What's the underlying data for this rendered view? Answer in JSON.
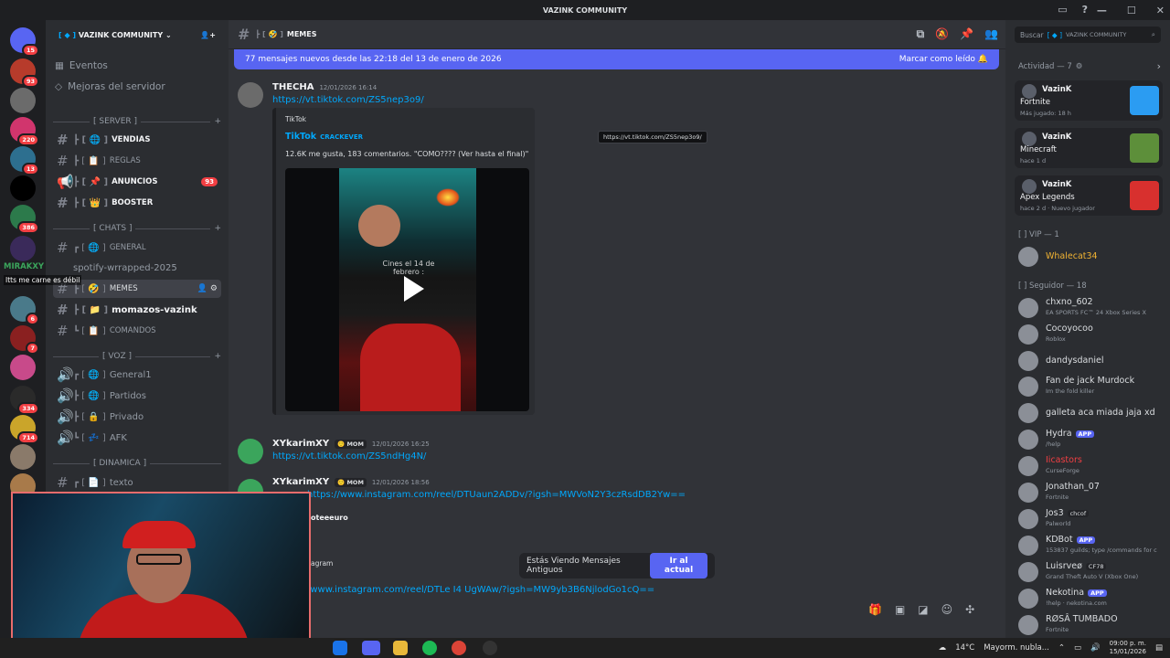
{
  "window": {
    "title": "VAZINK COMMUNITY"
  },
  "servers": [
    {
      "badge": "15"
    },
    {
      "badge": "93"
    },
    {
      "badge": ""
    },
    {
      "badge": "220"
    },
    {
      "badge": "13"
    },
    {
      "badge": ""
    },
    {
      "badge": "386"
    },
    {
      "badge": ""
    },
    {
      "badge": "6"
    },
    {
      "badge": "7"
    },
    {
      "badge": ""
    },
    {
      "badge": "334"
    },
    {
      "badge": "714"
    },
    {
      "badge": ""
    },
    {
      "badge": ""
    }
  ],
  "guild": {
    "name": "VAZINK COMMUNITY"
  },
  "nav": {
    "events": "Eventos",
    "boosts": "Mejoras del servidor"
  },
  "categories": {
    "server": "[ SERVER ]",
    "chats": "[ CHATS ]",
    "voz": "[ VOZ ]",
    "dinamica": "[ DINAMICA ]"
  },
  "channels": {
    "ventas": "VENDIAS",
    "reglas": "REGLAS",
    "anuncios": "ANUNCIOS",
    "anuncios_badge": "93",
    "booster": "BOOSTER",
    "general": "GENERAL",
    "spotify": "spotify-wrrapped-2025",
    "memes": "MEMES",
    "momazos": "momazos-vazink",
    "comandos": "COMANDOS",
    "general1": "General1",
    "partidos": "Partidos",
    "privado": "Privado",
    "afk": "AFK",
    "texto": "texto"
  },
  "overlay": {
    "user": "MIRAKXY",
    "message": "Itts me carne es débil"
  },
  "channel_header": {
    "name": "MEMES",
    "search_placeholder": "Buscar",
    "search_scope": "VAZINK COMMUNITY"
  },
  "new_messages": {
    "text": "77 mensajes nuevos desde las 22:18 del 13 de enero de 2026",
    "action": "Marcar como leído"
  },
  "messages": [
    {
      "author": "THECHA",
      "time": "12/01/2026 16:14",
      "link": "https://vt.tiktok.com/ZS5nep3o9/",
      "embed": {
        "provider": "TikTok",
        "title": "TikTok",
        "subtitle": "CRACKEVER",
        "desc": "12.6K me gusta, 183 comentarios. \"COMO???? (Ver hasta el final)\"",
        "caption": "Cines el 14 de febrero :"
      }
    },
    {
      "author": "XYkarimXY",
      "tag": "MOM",
      "time": "12/01/2026 16:25",
      "link": "https://vt.tiktok.com/ZS5ndHg4N/"
    },
    {
      "author": "XYkarimXY",
      "tag": "MOM",
      "time": "12/01/2026 18:56",
      "link": "https://www.instagram.com/reel/DTUaun2ADDv/?igsh=MWVoN2Y3czRsdDB2Yw==",
      "partial1": "oteeeuro",
      "partial2": "agram",
      "link2": "/www.instagram.com/reel/DTLe I4 UgWAw/?igsh=MW9yb3B6NjlodGo1cQ=="
    }
  ],
  "tooltip": "https://vt.tiktok.com/ZS5nep3o9/",
  "old_messages": {
    "text": "Estás Viendo Mensajes Antiguos",
    "button": "Ir al actual"
  },
  "members": {
    "activity_header": "Actividad — 7",
    "activities": [
      {
        "name": "VazinK",
        "game": "Fortnite",
        "sub": "Más jugado: 18 h",
        "color": "#2b9cf2"
      },
      {
        "name": "VazinK",
        "game": "Minecraft",
        "sub": "hace 1 d",
        "color": "#5d8f3a"
      },
      {
        "name": "VazinK",
        "game": "Apex Legends",
        "sub": "hace 2 d  ·  Nuevo jugador",
        "color": "#d8302e"
      }
    ],
    "vip_header": "[ ] VIP — 1",
    "vip": [
      {
        "name": "Whalecat34",
        "color": "#f0b232"
      }
    ],
    "follow_header": "[ ] Seguidor — 18",
    "list": [
      {
        "name": "chxno_602",
        "sub": "EA SPORTS FC™ 24 Xbox Series X"
      },
      {
        "name": "Cocoyocoo",
        "sub": "Roblox"
      },
      {
        "name": "dandysdaniel",
        "sub": ""
      },
      {
        "name": "Fan de jack Murdock",
        "sub": "Im the fold killer"
      },
      {
        "name": "galleta aca miada jaja xd",
        "sub": ""
      },
      {
        "name": "Hydra",
        "sub": "/help",
        "app": "APP"
      },
      {
        "name": "Iicastors",
        "sub": "CurseForge",
        "color": "#f23f43"
      },
      {
        "name": "Jonathan_07",
        "sub": "Fortnite"
      },
      {
        "name": "Jos3",
        "sub": "Palworld",
        "tag": "chcof"
      },
      {
        "name": "KDBot",
        "sub": "153837 guilds; type /commands for c",
        "app": "APP"
      },
      {
        "name": "Luisrveø",
        "sub": "Grand Theft Auto V (Xbox One)",
        "tag": "CF78"
      },
      {
        "name": "Nekotina",
        "sub": "!help · nekotina.com",
        "app": "APP"
      },
      {
        "name": "RØSÂ TUMBADO",
        "sub": "Fortnite"
      }
    ]
  },
  "taskbar": {
    "weather": "14°C",
    "weather_text": "Mayorm. nubla...",
    "time": "09:00 p. m.",
    "date": "15/01/2026"
  },
  "colors": {
    "accent": "#5865f2",
    "link": "#00a8fc",
    "badge": "#f23f43"
  }
}
